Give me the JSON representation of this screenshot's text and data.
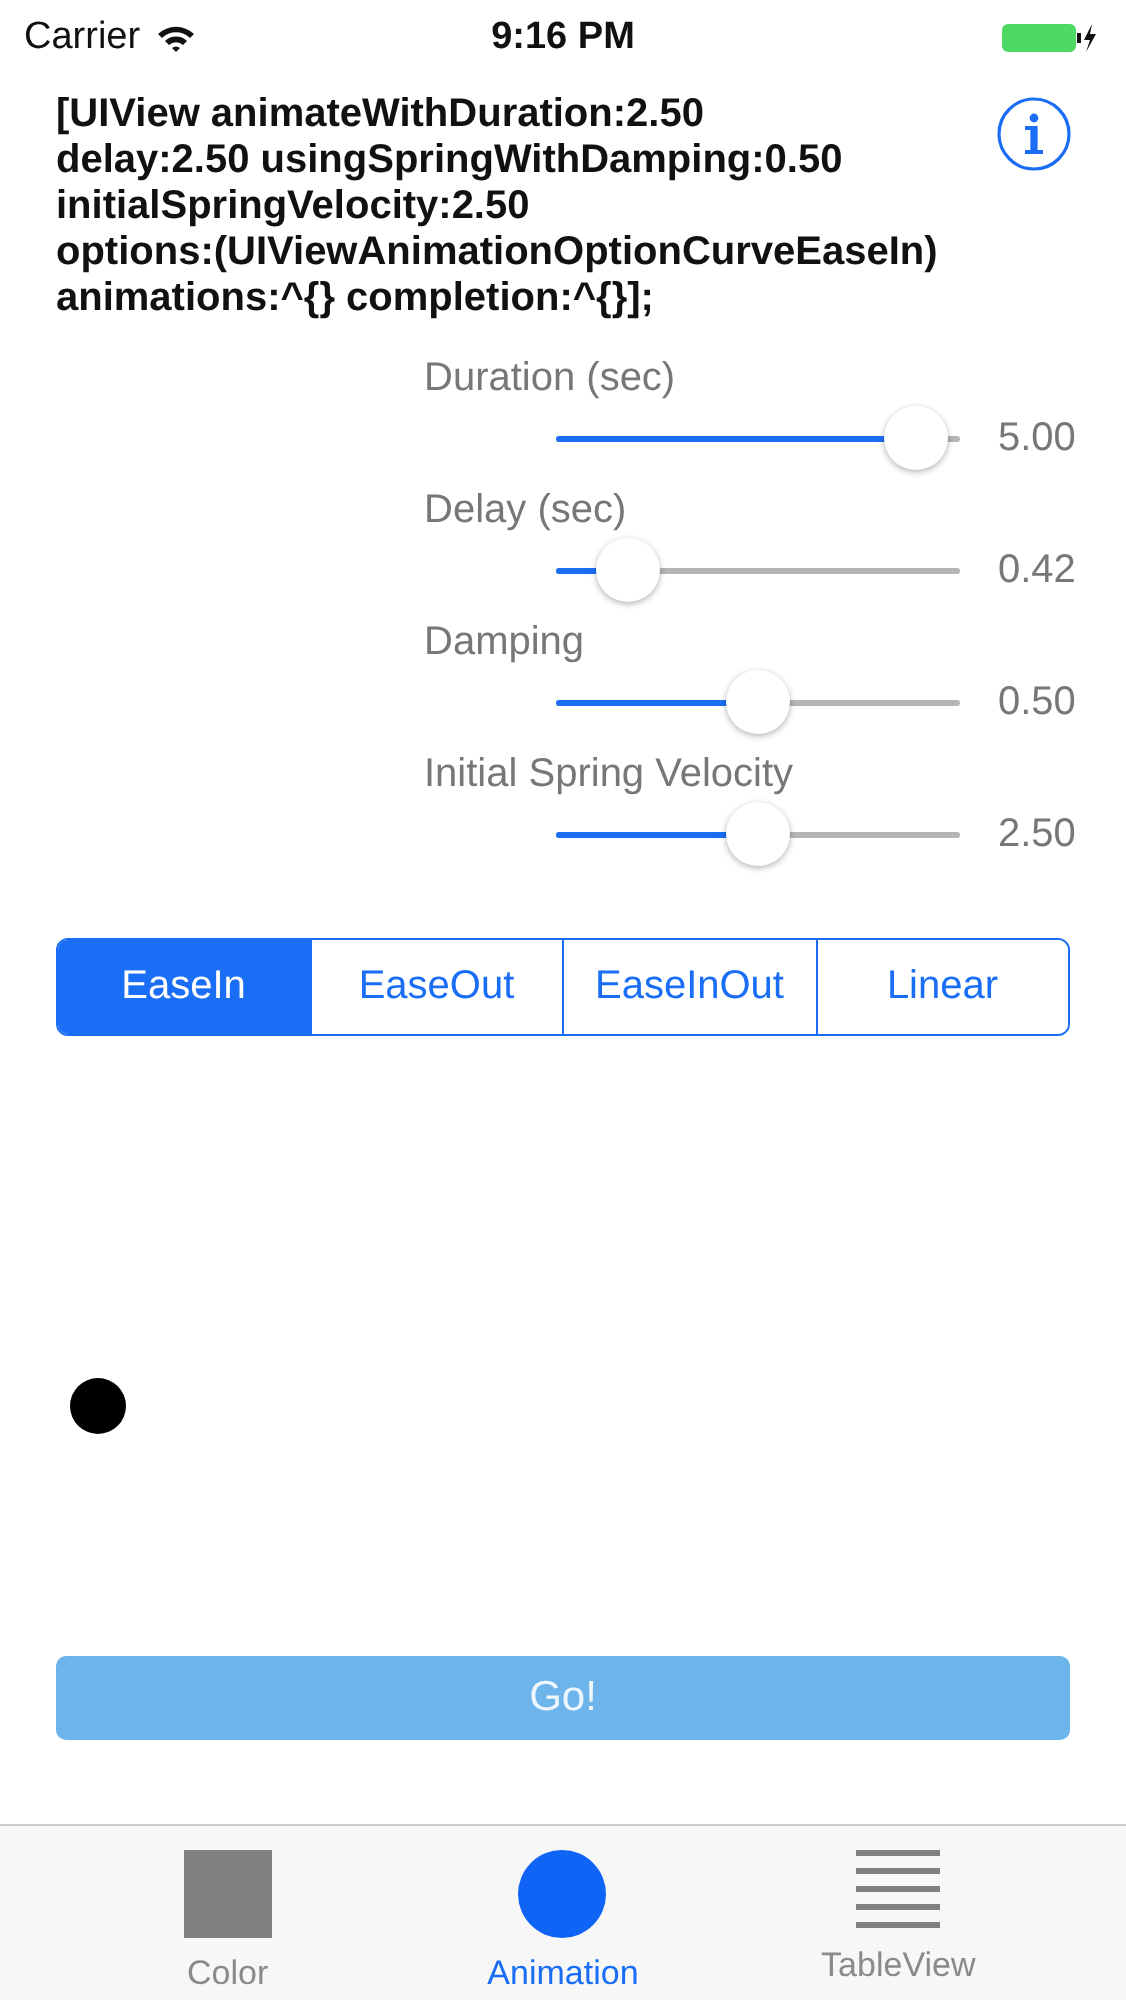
{
  "status_bar": {
    "carrier": "Carrier",
    "time": "9:16 PM"
  },
  "code_text": "[UIView animateWithDuration:2.50\ndelay:2.50 usingSpringWithDamping:0.50\ninitialSpringVelocity:2.50\noptions:(UIViewAnimationOptionCurveEaseIn)\nanimations:^{} completion:^{}];",
  "sliders": [
    {
      "label": "Duration (sec)",
      "level": 0.89,
      "reading": "5.00"
    },
    {
      "label": "Delay (sec)",
      "level": 0.18,
      "reading": "0.42"
    },
    {
      "label": "Damping",
      "level": 0.5,
      "reading": "0.50"
    },
    {
      "label": "Initial Spring Velocity",
      "level": 0.5,
      "reading": "2.50"
    }
  ],
  "segments": [
    {
      "label": "EaseIn",
      "selected": true
    },
    {
      "label": "EaseOut",
      "selected": false
    },
    {
      "label": "EaseInOut",
      "selected": false
    },
    {
      "label": "Linear",
      "selected": false
    }
  ],
  "go_button": {
    "label": "Go!",
    "disabled": true
  },
  "tabs": [
    {
      "label": "Color",
      "kind": "square",
      "selected": false
    },
    {
      "label": "Animation",
      "kind": "circle",
      "selected": true
    },
    {
      "label": "TableView",
      "kind": "lines",
      "selected": false
    }
  ]
}
